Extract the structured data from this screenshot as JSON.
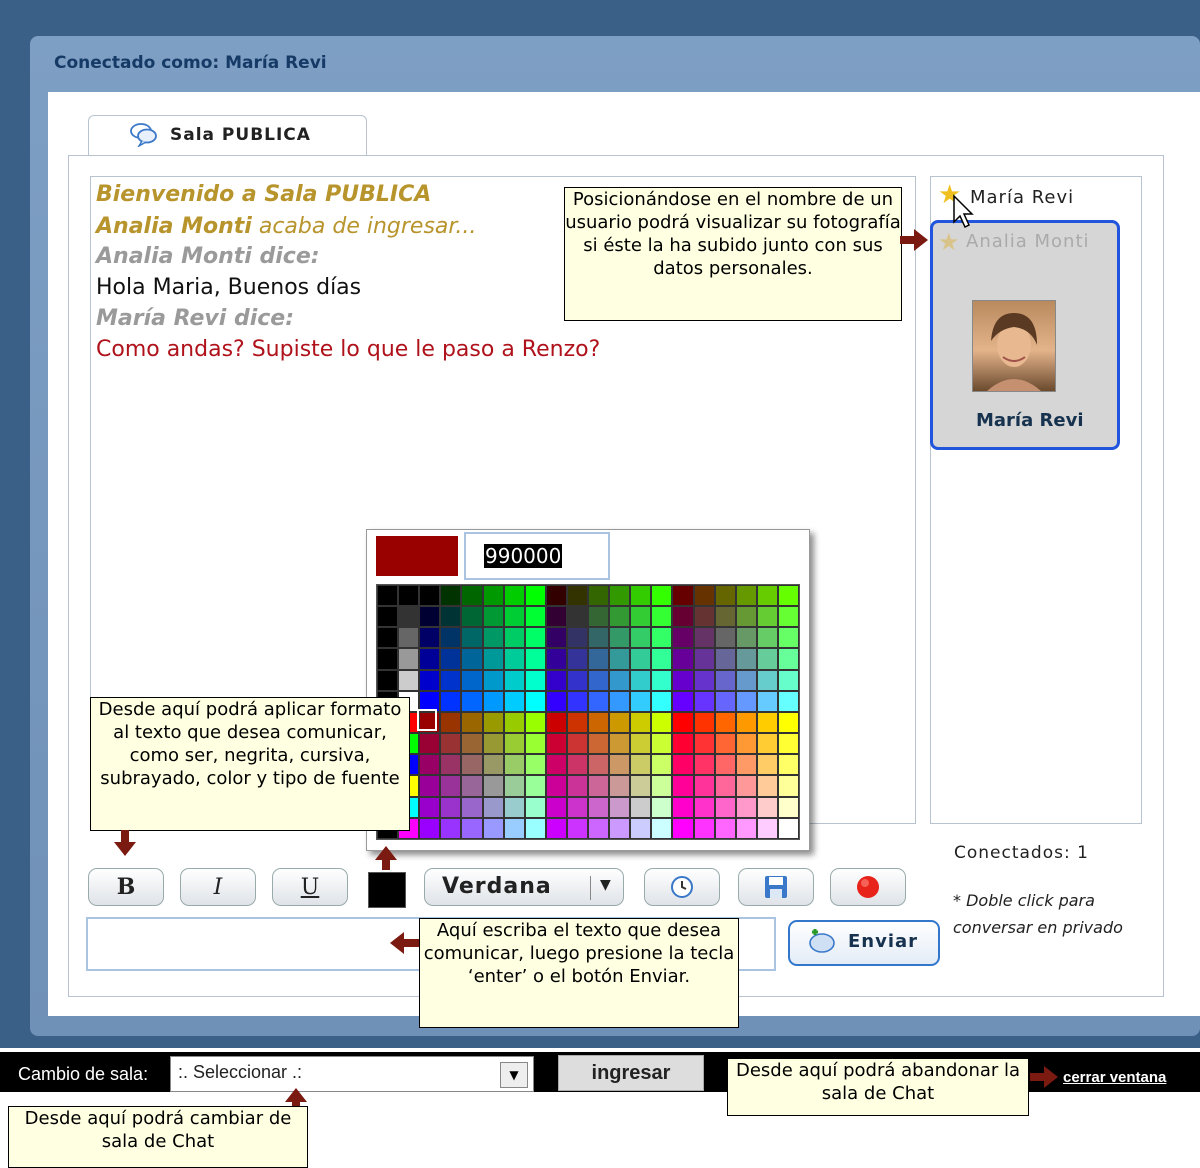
{
  "header": {
    "connected_label": "Conectado como: María Revi"
  },
  "tab": {
    "label": "Sala PUBLICA"
  },
  "messages": {
    "welcome": "Bienvenido a Sala PUBLICA",
    "join_user": "Analia Monti",
    "join_text": "acaba de ingresar...",
    "speaker1": "Analia Monti dice:",
    "message1": "Hola Maria, Buenos días",
    "speaker2": "María Revi dice:",
    "message2": "Como andas? Supiste lo que le paso a Renzo?"
  },
  "users": {
    "user1": "María Revi",
    "user2": "Analia Monti",
    "card_name": "María Revi",
    "connected_count": "Conectados: 1",
    "hint": "* Doble click para conversar en privado"
  },
  "color_picker": {
    "hex_value": "990000",
    "selected_color": "#990000"
  },
  "toolbar": {
    "bold_label": "B",
    "italic_label": "I",
    "underline_label": "U",
    "font_value": "Verdana",
    "send_label": "Enviar"
  },
  "bottom_bar": {
    "room_change_label": "Cambio de sala:",
    "room_select_value": ":. Seleccionar .:",
    "enter_label": "ingresar",
    "close_label": "cerrar ventana"
  },
  "notes": {
    "photo_hint": "Posicionándose en el nombre de un usuario podrá visualizar su fotografía si éste la ha subido junto con sus datos personales.",
    "format_hint": "Desde aquí podrá aplicar formato al texto que desea comunicar, como ser, negrita, cursiva, subrayado, color y tipo de fuente",
    "write_hint": "Aquí escriba el texto que desea comunicar, luego presione la tecla ‘enter’ o el botón Enviar.",
    "leave_hint": "Desde aquí podrá abandonar la sala de Chat",
    "room_hint": "Desde aquí podrá cambiar de sala de Chat"
  }
}
